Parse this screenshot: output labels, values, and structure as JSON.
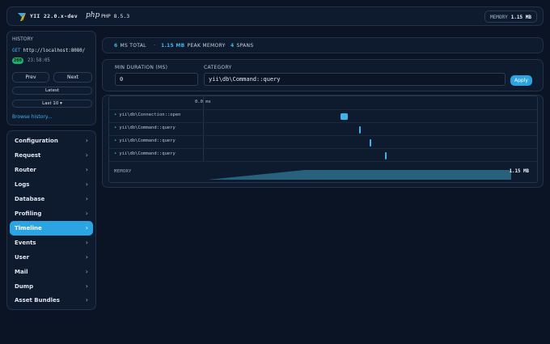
{
  "header": {
    "framework": "YII 22.0.x-dev",
    "php_label": "php",
    "php_version": "PHP 8.5.3",
    "memory_label": "MEMORY",
    "memory_value": "1.15 MB",
    "logo_icon": "yii-logo-icon"
  },
  "history": {
    "title": "HISTORY",
    "method": "GET",
    "url": "http://localhost:8080/",
    "status": "200",
    "time": "23:58:05",
    "prev": "Prev",
    "next": "Next",
    "latest": "Latest",
    "last": "Last 10 ▾",
    "browse": "Browse history..."
  },
  "nav": {
    "items": [
      {
        "label": "Configuration"
      },
      {
        "label": "Request"
      },
      {
        "label": "Router"
      },
      {
        "label": "Logs"
      },
      {
        "label": "Database"
      },
      {
        "label": "Profiling"
      },
      {
        "label": "Timeline"
      },
      {
        "label": "Events"
      },
      {
        "label": "User"
      },
      {
        "label": "Mail"
      },
      {
        "label": "Dump"
      },
      {
        "label": "Asset Bundles"
      }
    ],
    "active": "Timeline",
    "chevron": "›"
  },
  "summary": {
    "total_num": "6",
    "total_label": "MS TOTAL",
    "peak_num": "1.15 MB",
    "peak_label": "PEAK MEMORY",
    "spans_num": "4",
    "spans_label": "SPANS"
  },
  "filters": {
    "min_label": "MIN DURATION (MS)",
    "min_value": "0",
    "category_label": "CATEGORY",
    "category_value": "yii\\db\\Command::query",
    "apply": "Apply"
  },
  "timeline": {
    "axis_start": "0.0 ms",
    "spans": [
      {
        "label": "yii\\db\\Connection::open",
        "start": 0.41,
        "width": 0.022
      },
      {
        "label": "yii\\db\\Command::query",
        "start": 0.466,
        "width": 0.004
      },
      {
        "label": "yii\\db\\Command::query",
        "start": 0.497,
        "width": 0.004
      },
      {
        "label": "yii\\db\\Command::query",
        "start": 0.543,
        "width": 0.004
      }
    ],
    "memory_label": "MEMORY",
    "memory_value": "1.15 MB"
  },
  "colors": {
    "accent": "#2ba4e3",
    "status_ok": "#1fae6b",
    "memory_fill": "#2b6f8a"
  }
}
